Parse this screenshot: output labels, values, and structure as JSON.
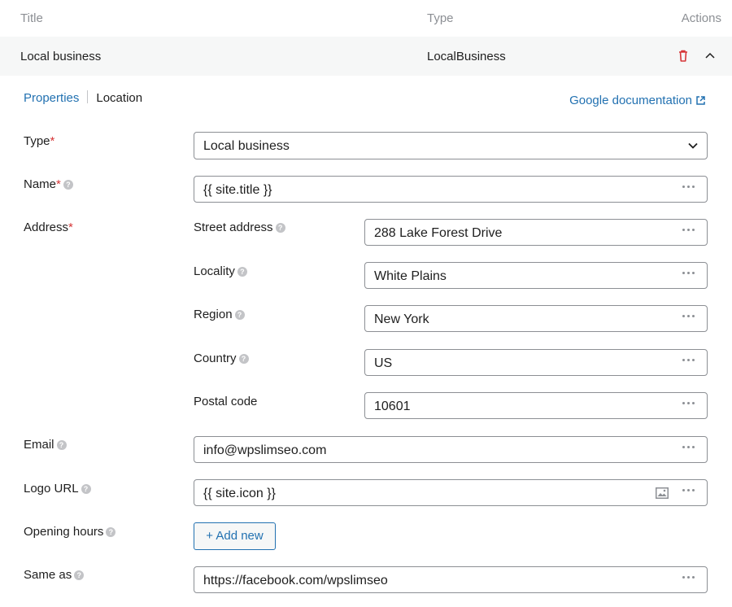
{
  "table_header": {
    "title": "Title",
    "type": "Type",
    "actions": "Actions"
  },
  "item": {
    "title": "Local business",
    "type": "LocalBusiness"
  },
  "tabs": {
    "properties": "Properties",
    "location": "Location"
  },
  "google_doc_link": "Google documentation",
  "fields": {
    "type": {
      "label": "Type",
      "required": "*",
      "value": "Local business"
    },
    "name": {
      "label": "Name",
      "required": "*",
      "value": "{{ site.title }}"
    },
    "address": {
      "label": "Address",
      "required": "*",
      "street": {
        "label": "Street address",
        "value": "288 Lake Forest Drive"
      },
      "locality": {
        "label": "Locality",
        "value": "White Plains"
      },
      "region": {
        "label": "Region",
        "value": "New York"
      },
      "country": {
        "label": "Country",
        "value": "US"
      },
      "postal": {
        "label": "Postal code",
        "value": "10601"
      }
    },
    "email": {
      "label": "Email",
      "value": "info@wpslimseo.com"
    },
    "logo": {
      "label": "Logo URL",
      "value": "{{ site.icon }}"
    },
    "hours": {
      "label": "Opening hours",
      "button": "+ Add new"
    },
    "same_as": {
      "label": "Same as",
      "value": "https://facebook.com/wpslimseo"
    }
  },
  "help_glyph": "?",
  "colors": {
    "accent": "#2271b1",
    "required": "#d63638",
    "row_bg": "#f6f7f7"
  }
}
